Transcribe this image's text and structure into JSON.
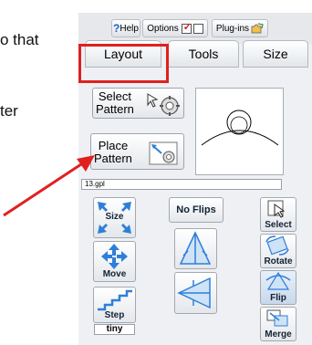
{
  "background_text": {
    "line1": "o that",
    "line2": "ter"
  },
  "toolbar": {
    "help_label": "Help",
    "options_label": "Options",
    "plugins_label": "Plug-ins"
  },
  "tabs": [
    {
      "label": "Layout",
      "active": true
    },
    {
      "label": "Tools",
      "active": false
    },
    {
      "label": "Size",
      "active": false
    }
  ],
  "pattern_buttons": {
    "select_line1": "Select",
    "select_line2": "Pattern",
    "place_line1": "Place",
    "place_line2": "Pattern"
  },
  "file": {
    "name": "13.gpl"
  },
  "tools": {
    "size_label": "Size",
    "move_label": "Move",
    "step_label": "Step",
    "step_value": "tiny",
    "no_flips_label": "No Flips",
    "select_label": "Select",
    "rotate_label": "Rotate",
    "flip_label": "Flip",
    "merge_label": "Merge"
  },
  "colors": {
    "highlight_red": "#e02020",
    "icon_blue": "#2f7fd8"
  }
}
